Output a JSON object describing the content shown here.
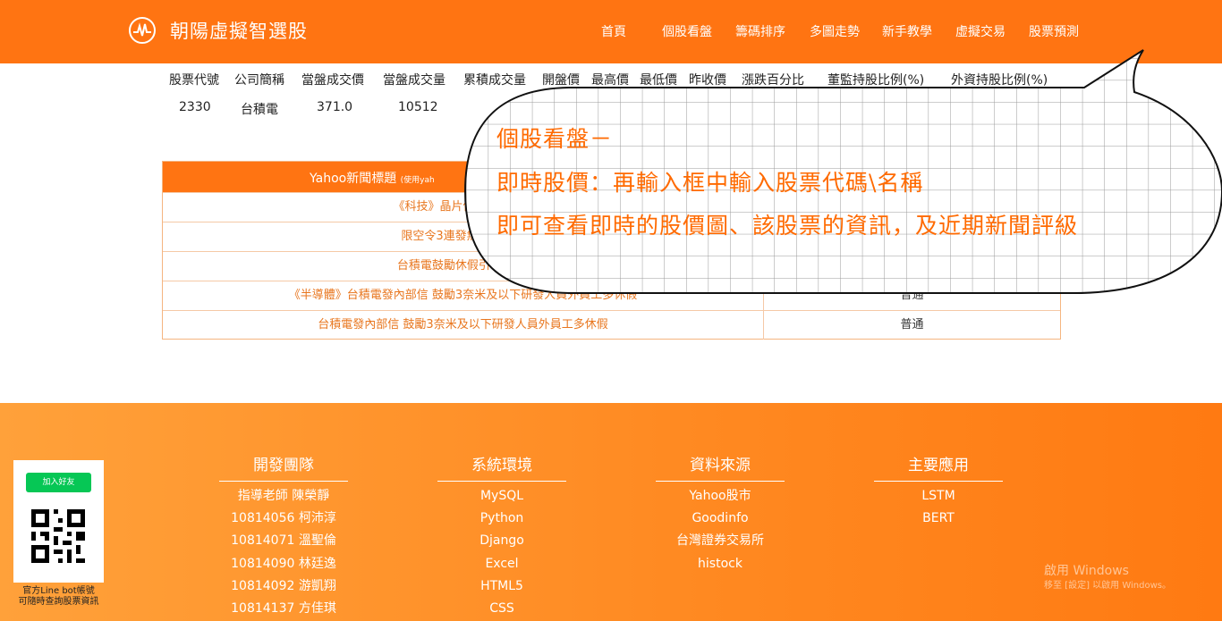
{
  "header": {
    "brand": "朝陽虛擬智選股",
    "nav": [
      "首頁",
      "個股看盤",
      "籌碼排序",
      "多圖走勢",
      "新手教學",
      "虛擬交易",
      "股票預測"
    ]
  },
  "stock": {
    "headers": [
      "股票代號",
      "公司簡稱",
      "當盤成交價",
      "當盤成交量",
      "累積成交量",
      "開盤價",
      "最高價",
      "最低價",
      "昨收價",
      "漲跌百分比",
      "董監持股比例(%)",
      "外資持股比例(%)"
    ],
    "values": [
      "2330",
      "台積電",
      "371.0",
      "10512"
    ]
  },
  "news": {
    "header": "Yahoo新聞標題",
    "header_note": "(使用yah",
    "rows": [
      {
        "title": "《科技》晶片供應鏈離台必",
        "rating": ""
      },
      {
        "title": "限空令3連發無效！台積",
        "rating": ""
      },
      {
        "title": "台積電鼓勵休假引聯想 緩",
        "rating": ""
      },
      {
        "title": "《半導體》台積電發內部信 鼓勵3奈米及以下研發人員外員工多休假",
        "rating": "普通"
      },
      {
        "title": "台積電發內部信 鼓勵3奈米及以下研發人員外員工多休假",
        "rating": "普通"
      }
    ]
  },
  "callout": {
    "lines": [
      "個股看盤－",
      "即時股價：再輸入框中輸入股票代碼\\名稱",
      "即可查看即時的股價圖、該股票的資訊，及近期新聞評級"
    ]
  },
  "footer": {
    "line_button": "加入好友",
    "qr_caption": [
      "官方Line bot帳號",
      "可隨時查詢股票資訊"
    ],
    "columns": [
      {
        "heading": "開發團隊",
        "items": [
          "指導老師 陳榮靜",
          "10814056 柯沛淳",
          "10814071 溫聖倫",
          "10814090 林廷逸",
          "10814092 游凱翔",
          "10814137 方佳琪"
        ]
      },
      {
        "heading": "系統環境",
        "items": [
          "MySQL",
          "Python",
          "Django",
          "Excel",
          "HTML5",
          "CSS"
        ]
      },
      {
        "heading": "資料來源",
        "items": [
          "Yahoo股市",
          "Goodinfo",
          "台灣證券交易所",
          "histock"
        ]
      },
      {
        "heading": "主要應用",
        "items": [
          "LSTM",
          "BERT"
        ]
      }
    ],
    "watermark": [
      "啟用 Windows",
      "移至 [設定] 以啟用 Windows。"
    ]
  }
}
